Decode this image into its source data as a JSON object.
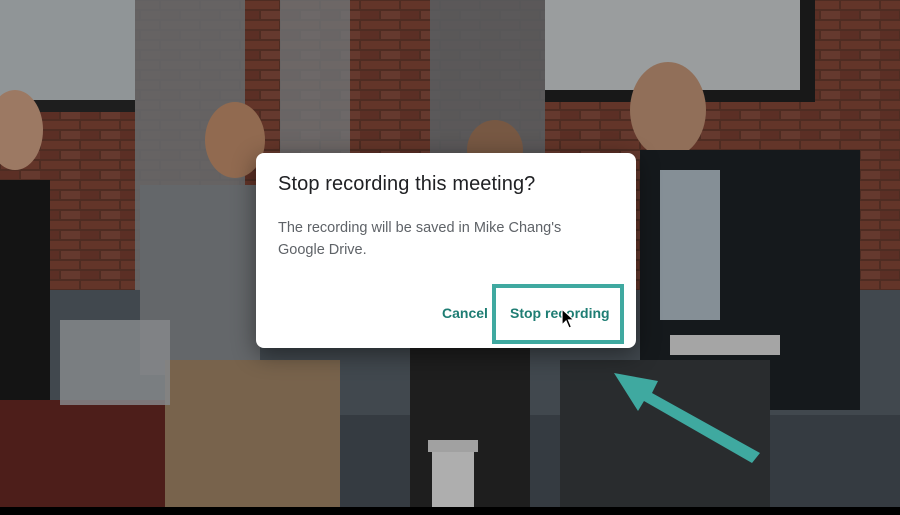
{
  "dialog": {
    "title": "Stop recording this meeting?",
    "body": "The recording will be saved in Mike Chang's Google Drive.",
    "cancel_label": "Cancel",
    "stop_label": "Stop recording"
  },
  "colors": {
    "accent": "#1e7d73",
    "highlight": "#3fa9a0",
    "title_text": "#202124",
    "body_text": "#5f6368"
  }
}
